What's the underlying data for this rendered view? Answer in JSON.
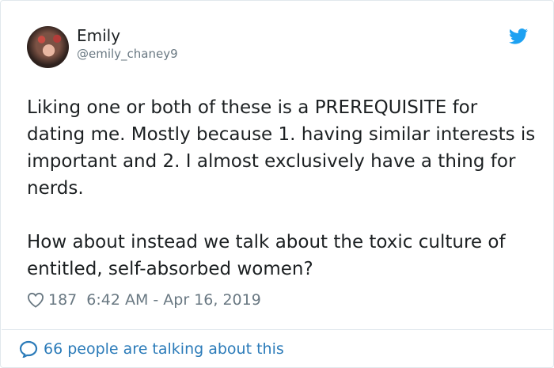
{
  "user": {
    "name": "Emily",
    "handle": "@emily_chaney9"
  },
  "tweet": {
    "paragraphs": [
      "Liking one or both of these is a PREREQUISITE for dating me. Mostly because 1. having similar interests is important and 2. I almost exclusively have a thing for nerds.",
      "How about instead we talk about the toxic culture of entitled, self-absorbed women?"
    ]
  },
  "meta": {
    "likes": "187",
    "timestamp": "6:42 AM - Apr 16, 2019"
  },
  "footer": {
    "talking": "66 people are talking about this"
  },
  "icons": {
    "brand": "twitter-bird-icon",
    "like": "heart-icon",
    "reply": "speech-bubble-icon"
  },
  "colors": {
    "brand": "#1da1f2",
    "link": "#2b7bb9",
    "muted": "#697882",
    "text": "#1c2022"
  }
}
